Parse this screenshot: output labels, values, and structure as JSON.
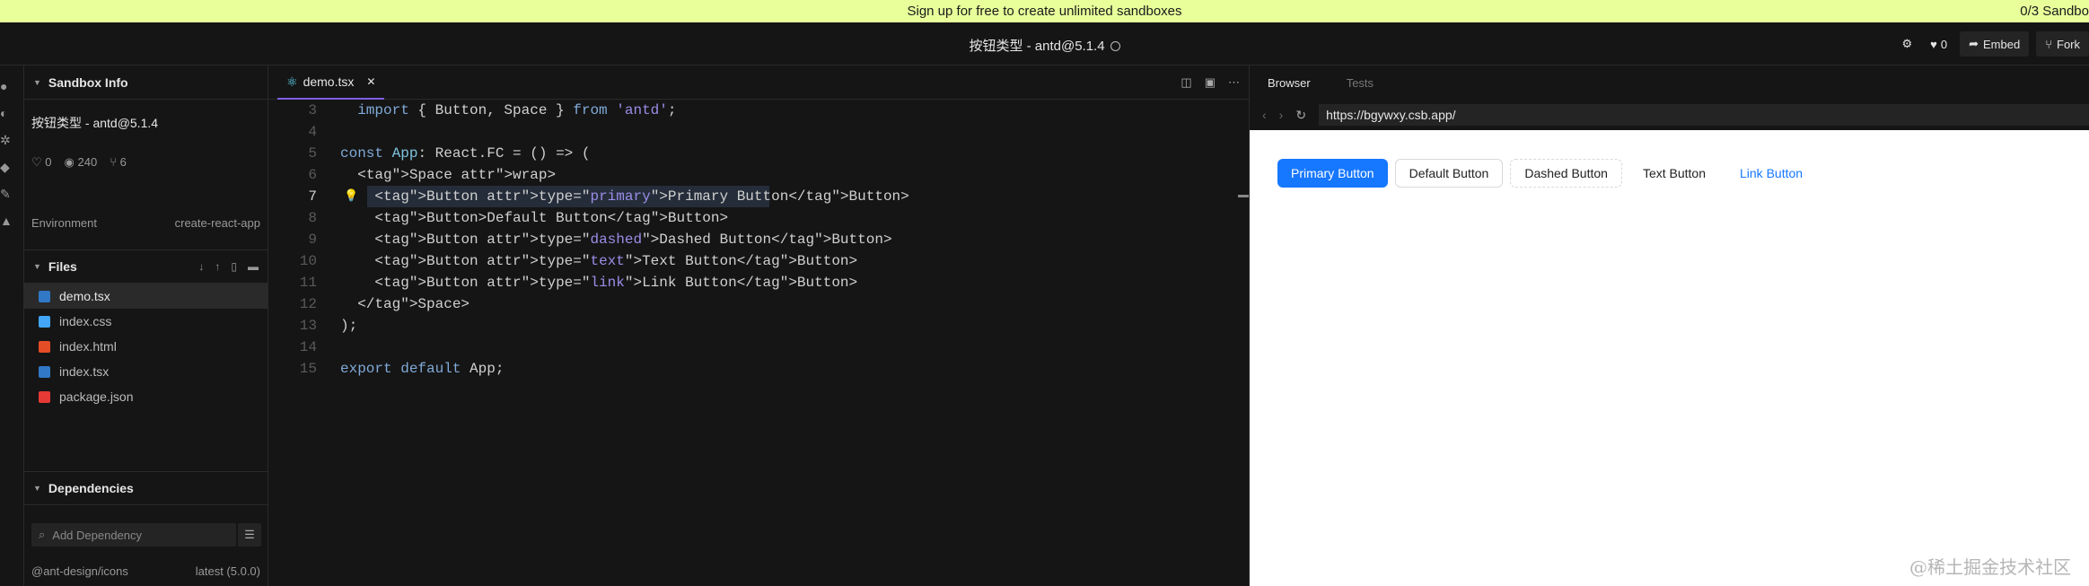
{
  "banner": {
    "message": "Sign up for free to create unlimited sandboxes",
    "counter": "0/3 Sandbo"
  },
  "header": {
    "title": "按钮类型 - antd@5.1.4",
    "likes": "0",
    "embed_label": "Embed",
    "fork_label": "Fork"
  },
  "sidebar": {
    "info_title": "Sandbox Info",
    "sandbox_name": "按钮类型 - antd@5.1.4",
    "stats": {
      "likes": "0",
      "views": "240",
      "forks": "6"
    },
    "environment_label": "Environment",
    "environment_value": "create-react-app",
    "files_title": "Files",
    "files": [
      {
        "name": "demo.tsx",
        "icon": "tsx-file-icon",
        "color": "#3178c6"
      },
      {
        "name": "index.css",
        "icon": "css-file-icon",
        "color": "#42a5f5"
      },
      {
        "name": "index.html",
        "icon": "html-file-icon",
        "color": "#e44d26"
      },
      {
        "name": "index.tsx",
        "icon": "tsx-file-icon",
        "color": "#3178c6"
      },
      {
        "name": "package.json",
        "icon": "json-file-icon",
        "color": "#e53935"
      }
    ],
    "dependencies_title": "Dependencies",
    "dependency_placeholder": "Add Dependency",
    "dependency": {
      "name": "@ant-design/icons",
      "version": "latest (5.0.0)"
    }
  },
  "editor": {
    "tab_label": "demo.tsx",
    "lines": [
      {
        "n": "3",
        "code": "  import { Button, Space } from 'antd';"
      },
      {
        "n": "4",
        "code": ""
      },
      {
        "n": "5",
        "code": "const App: React.FC = () => ("
      },
      {
        "n": "6",
        "code": "  <Space wrap>"
      },
      {
        "n": "7",
        "code": "    <Button type=\"primary\">Primary Button</Button>"
      },
      {
        "n": "8",
        "code": "    <Button>Default Button</Button>"
      },
      {
        "n": "9",
        "code": "    <Button type=\"dashed\">Dashed Button</Button>"
      },
      {
        "n": "10",
        "code": "    <Button type=\"text\">Text Button</Button>"
      },
      {
        "n": "11",
        "code": "    <Button type=\"link\">Link Button</Button>"
      },
      {
        "n": "12",
        "code": "  </Space>"
      },
      {
        "n": "13",
        "code": ");"
      },
      {
        "n": "14",
        "code": ""
      },
      {
        "n": "15",
        "code": "export default App;"
      }
    ]
  },
  "preview": {
    "tabs": [
      "Browser",
      "Tests"
    ],
    "url": "https://bgywxy.csb.app/",
    "buttons": [
      "Primary Button",
      "Default Button",
      "Dashed Button",
      "Text Button",
      "Link Button"
    ]
  },
  "watermark": "@稀土掘金技术社区"
}
